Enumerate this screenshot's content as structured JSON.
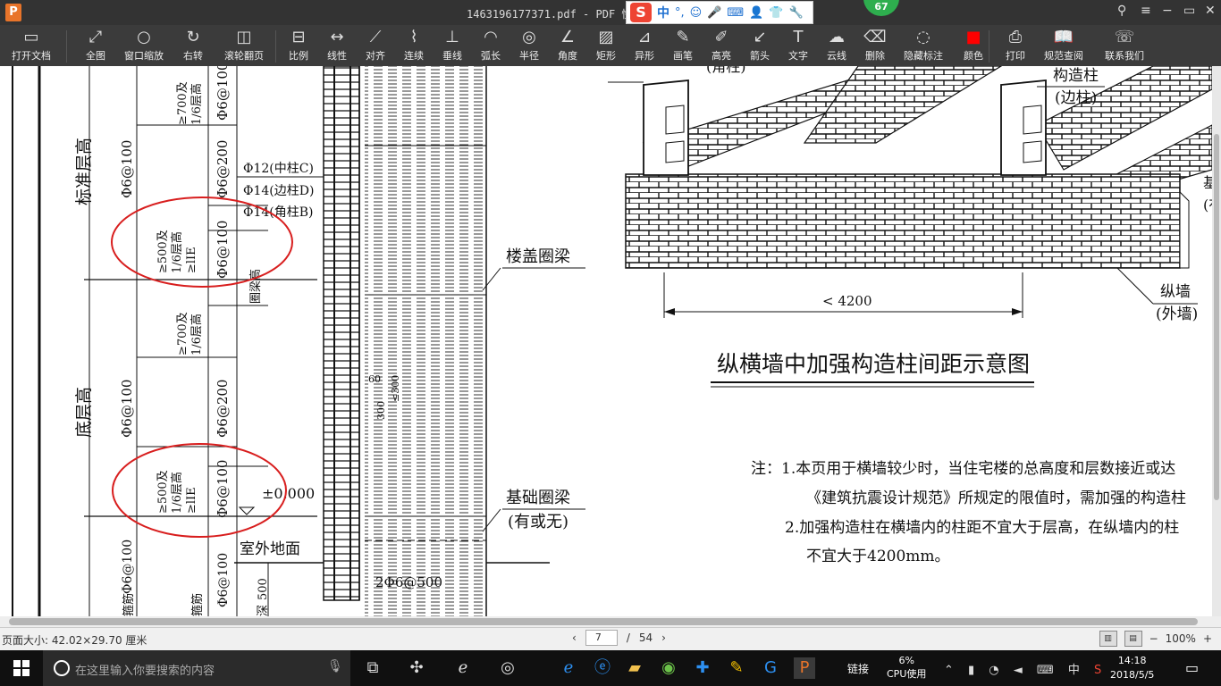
{
  "window": {
    "app_logo": "P",
    "title": "1463196177371.pdf - PDF 快速看",
    "badge": "67"
  },
  "ime": {
    "logo": "S",
    "lang": "中",
    "icons": [
      "°,",
      "☺",
      "🎤",
      "⌨",
      "👤",
      "👕",
      "🔧"
    ]
  },
  "toolbar": {
    "items": [
      {
        "label": "打开文档",
        "icon": "folder-icon",
        "glyph": "▭"
      },
      {
        "label": "全图",
        "icon": "fit-page-icon",
        "glyph": "⤢"
      },
      {
        "label": "窗口缩放",
        "icon": "zoom-window-icon",
        "glyph": "○"
      },
      {
        "label": "右转",
        "icon": "rotate-icon",
        "glyph": "↻"
      },
      {
        "label": "滚轮翻页",
        "icon": "mouse-icon",
        "glyph": "◫"
      },
      {
        "label": "比例",
        "icon": "scale-icon",
        "glyph": "⊟"
      },
      {
        "label": "线性",
        "icon": "linear-icon",
        "glyph": "↔"
      },
      {
        "label": "对齐",
        "icon": "align-icon",
        "glyph": "⟋"
      },
      {
        "label": "连续",
        "icon": "continuous-icon",
        "glyph": "⌇"
      },
      {
        "label": "垂线",
        "icon": "perpendicular-icon",
        "glyph": "⊥"
      },
      {
        "label": "弧长",
        "icon": "arc-length-icon",
        "glyph": "◠"
      },
      {
        "label": "半径",
        "icon": "radius-icon",
        "glyph": "◎"
      },
      {
        "label": "角度",
        "icon": "angle-icon",
        "glyph": "∠"
      },
      {
        "label": "矩形",
        "icon": "rectangle-icon",
        "glyph": "▨"
      },
      {
        "label": "异形",
        "icon": "polygon-icon",
        "glyph": "⊿"
      },
      {
        "label": "画笔",
        "icon": "pen-icon",
        "glyph": "✎"
      },
      {
        "label": "高亮",
        "icon": "highlight-icon",
        "glyph": "✐"
      },
      {
        "label": "箭头",
        "icon": "arrow-icon",
        "glyph": "↙"
      },
      {
        "label": "文字",
        "icon": "text-icon",
        "glyph": "T"
      },
      {
        "label": "云线",
        "icon": "cloud-icon",
        "glyph": "☁"
      },
      {
        "label": "删除",
        "icon": "eraser-icon",
        "glyph": "⌫"
      },
      {
        "label": "隐藏标注",
        "icon": "hide-icon",
        "glyph": "◌"
      },
      {
        "label": "颜色",
        "icon": "color-icon",
        "glyph": "■",
        "color": "#ff0000"
      },
      {
        "label": "打印",
        "icon": "print-icon",
        "glyph": "⎙"
      },
      {
        "label": "规范查阅",
        "icon": "book-icon",
        "glyph": "📖"
      },
      {
        "label": "联系我们",
        "icon": "contact-icon",
        "glyph": "☏"
      }
    ]
  },
  "document": {
    "left_drawing": {
      "labels_vertical": [
        "标准层高",
        "底层高"
      ],
      "column_labels": [
        "Φ6@100",
        "Φ6@100",
        "Φ6@200",
        "Φ6@100",
        "Φ6@100",
        "Φ6@200",
        "Φ6@100",
        "Φ6@100",
        "Φ6@100"
      ],
      "upper_notes": [
        "≥700及",
        "1/6层高"
      ],
      "circle_notes": [
        "≥500及",
        "1/6层高",
        "≥lIE"
      ],
      "rebar_notes": [
        "Φ12(中柱C)",
        "Φ14(边柱D)",
        "Φ14(角柱B)"
      ],
      "beam_label": "圈梁高",
      "floor_beam": "楼盖圈梁",
      "base_beam": "基础圈梁",
      "base_beam_note": "(有或无)",
      "elevation": "±0.000",
      "outdoor": "室外地面",
      "bottom_rebar": "2Φ6@500",
      "dim_60": "60",
      "dim_300": "≤300",
      "dim_300b": "300",
      "stirrup": "箍筋",
      "depth": "500",
      "depth_note": "深"
    },
    "right_drawing": {
      "corner_note": "(角柱)",
      "column_label": "构造柱",
      "column_note": "(边柱)",
      "partial_label": "基",
      "partial_note": "(有",
      "wall_label": "纵墙",
      "wall_note": "(外墙)",
      "spacing": "< 4200",
      "title": "纵横墙中加强构造柱间距示意图",
      "notes": [
        "注：1.本页用于横墙较少时，当住宅楼的总高度和层数接近或达",
        "《建筑抗震设计规范》所规定的限值时，需加强的构造柱",
        "2.加强构造柱在横墙内的柱距不宜大于层高，在纵墙内的柱",
        "不宜大于4200mm。"
      ]
    }
  },
  "status": {
    "page_size": "页面大小: 42.02×29.70 厘米",
    "current_page": "7",
    "separator": "/",
    "total_pages": "54",
    "zoom": "100%",
    "zoom_minus": "−",
    "zoom_plus": "+"
  },
  "taskbar": {
    "search_placeholder": "在这里输入你要搜索的内容",
    "link_label": "链接",
    "cpu_percent": "6%",
    "cpu_label": "CPU使用",
    "ime_lang": "中",
    "time": "14:18",
    "date": "2018/5/5"
  }
}
